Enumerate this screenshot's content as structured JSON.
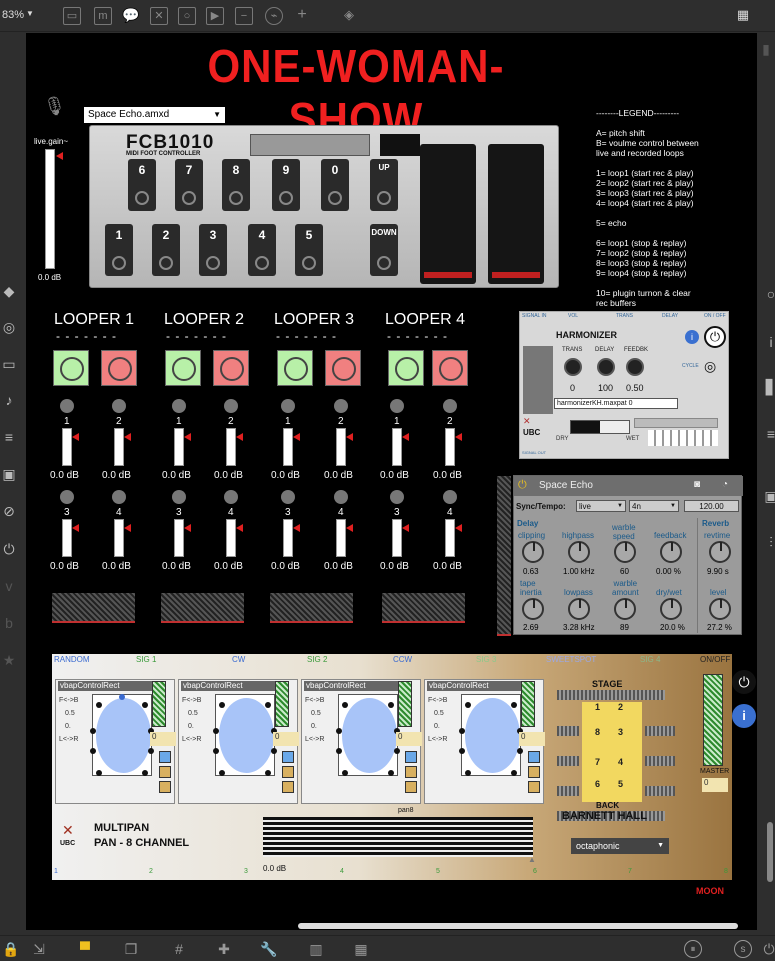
{
  "topbar": {
    "zoom": "83%"
  },
  "canvas": {
    "title": "ONE-WOMAN-SHOW",
    "patch_menu": "Space Echo.amxd",
    "live_gain_label": "live.gain~",
    "live_gain_value": "0.0 dB",
    "legend": "--------LEGEND---------\n\nA= pitch shift\nB= voulme control between\nlive and recorded loops\n\n1= loop1 (start rec & play)\n2= loop2 (start rec & play)\n3= loop3 (start rec & play)\n4= loop4 (start rec & play)\n\n5= echo\n\n6= loop1 (stop & replay)\n7= loop2 (stop & replay)\n8= loop3 (stop & replay)\n9= loop4 (stop & replay)\n\n10= plugin turnon & clear\nrec buffers",
    "fcb": {
      "logo": "FCB1010",
      "sub": "MIDI FOOT CONTROLLER",
      "top_pedals": [
        "6",
        "7",
        "8",
        "9",
        "0",
        "UP"
      ],
      "bottom_pedals": [
        "1",
        "2",
        "3",
        "4",
        "5",
        "DOWN"
      ]
    },
    "loopers": [
      {
        "title": "LOOPER 1",
        "dashes": "- - - - - - -",
        "ch": [
          "1",
          "2",
          "3",
          "4"
        ],
        "db": "0.0 dB"
      },
      {
        "title": "LOOPER 2",
        "dashes": "- - - - - - -",
        "ch": [
          "1",
          "2",
          "3",
          "4"
        ],
        "db": "0.0 dB"
      },
      {
        "title": "LOOPER 3",
        "dashes": "- - - - - - -",
        "ch": [
          "1",
          "2",
          "3",
          "4"
        ],
        "db": "0.0 dB"
      },
      {
        "title": "LOOPER 4",
        "dashes": "- - - - - - -",
        "ch": [
          "1",
          "2",
          "3",
          "4"
        ],
        "db": "0.0 dB"
      }
    ],
    "harmonizer": {
      "hdr": [
        "SIGNAL IN",
        "VOL",
        "TRANS",
        "DELAY",
        "ON / OFF"
      ],
      "title": "HARMONIZER",
      "knob_labels": [
        "TRANS",
        "DELAY",
        "FEEDBK"
      ],
      "knob_values": [
        "0",
        "100",
        "0.50"
      ],
      "cycle": "CYCLE",
      "file": "harmonizerKH.maxpat 0",
      "dry": "DRY",
      "wet": "WET",
      "signal_out": "SIGNAL OUT",
      "logo": "UBC"
    },
    "space_echo": {
      "title": "Space Echo",
      "sync_label": "Sync/Tempo:",
      "sync_value": "live",
      "note_value": "4n",
      "tempo": "120.00",
      "delay_label": "Delay",
      "reverb_label": "Reverb",
      "row1": [
        {
          "label": "clipping",
          "value": "0.63"
        },
        {
          "label": "highpass",
          "value": "1.00 kHz"
        },
        {
          "label": "warble\nspeed",
          "value": "60"
        },
        {
          "label": "feedback",
          "value": "0.00 %"
        },
        {
          "label": "revtime",
          "value": "9.90 s"
        }
      ],
      "row2": [
        {
          "label": "tape\ninertia",
          "value": "2.69"
        },
        {
          "label": "lowpass",
          "value": "3.28 kHz"
        },
        {
          "label": "warble\namount",
          "value": "89"
        },
        {
          "label": "dry/wet",
          "value": "20.0 %"
        },
        {
          "label": "level",
          "value": "27.2 %"
        }
      ]
    },
    "multipan": {
      "hdr": [
        "RANDOM",
        "SIG 1",
        "CW",
        "SIG 2",
        "CCW",
        "SIG 3",
        "SWEETSPOT",
        "SIG 4",
        "ON/OFF"
      ],
      "vbap_title": "vbapControlRect",
      "fb": "F<->B",
      "v1": "0.5",
      "v2": "0.",
      "lr": "L<->R",
      "spk_num": "0",
      "stage": "STAGE",
      "back": "BACK",
      "hall": "BARNETT HALL",
      "seats": [
        "1",
        "2",
        "8",
        "3",
        "7",
        "4",
        "6",
        "5"
      ],
      "master": "MASTER",
      "master_value": "0",
      "logo1": "MULTIPAN",
      "logo2": "PAN - 8 CHANNEL",
      "ubc": "UBC",
      "pan_label": "pan8",
      "pan_db": "0.0 dB",
      "mode": "octaphonic",
      "channels": [
        "1",
        "2",
        "3",
        "4",
        "5",
        "6",
        "7",
        "8"
      ]
    },
    "moon": "MOON"
  }
}
